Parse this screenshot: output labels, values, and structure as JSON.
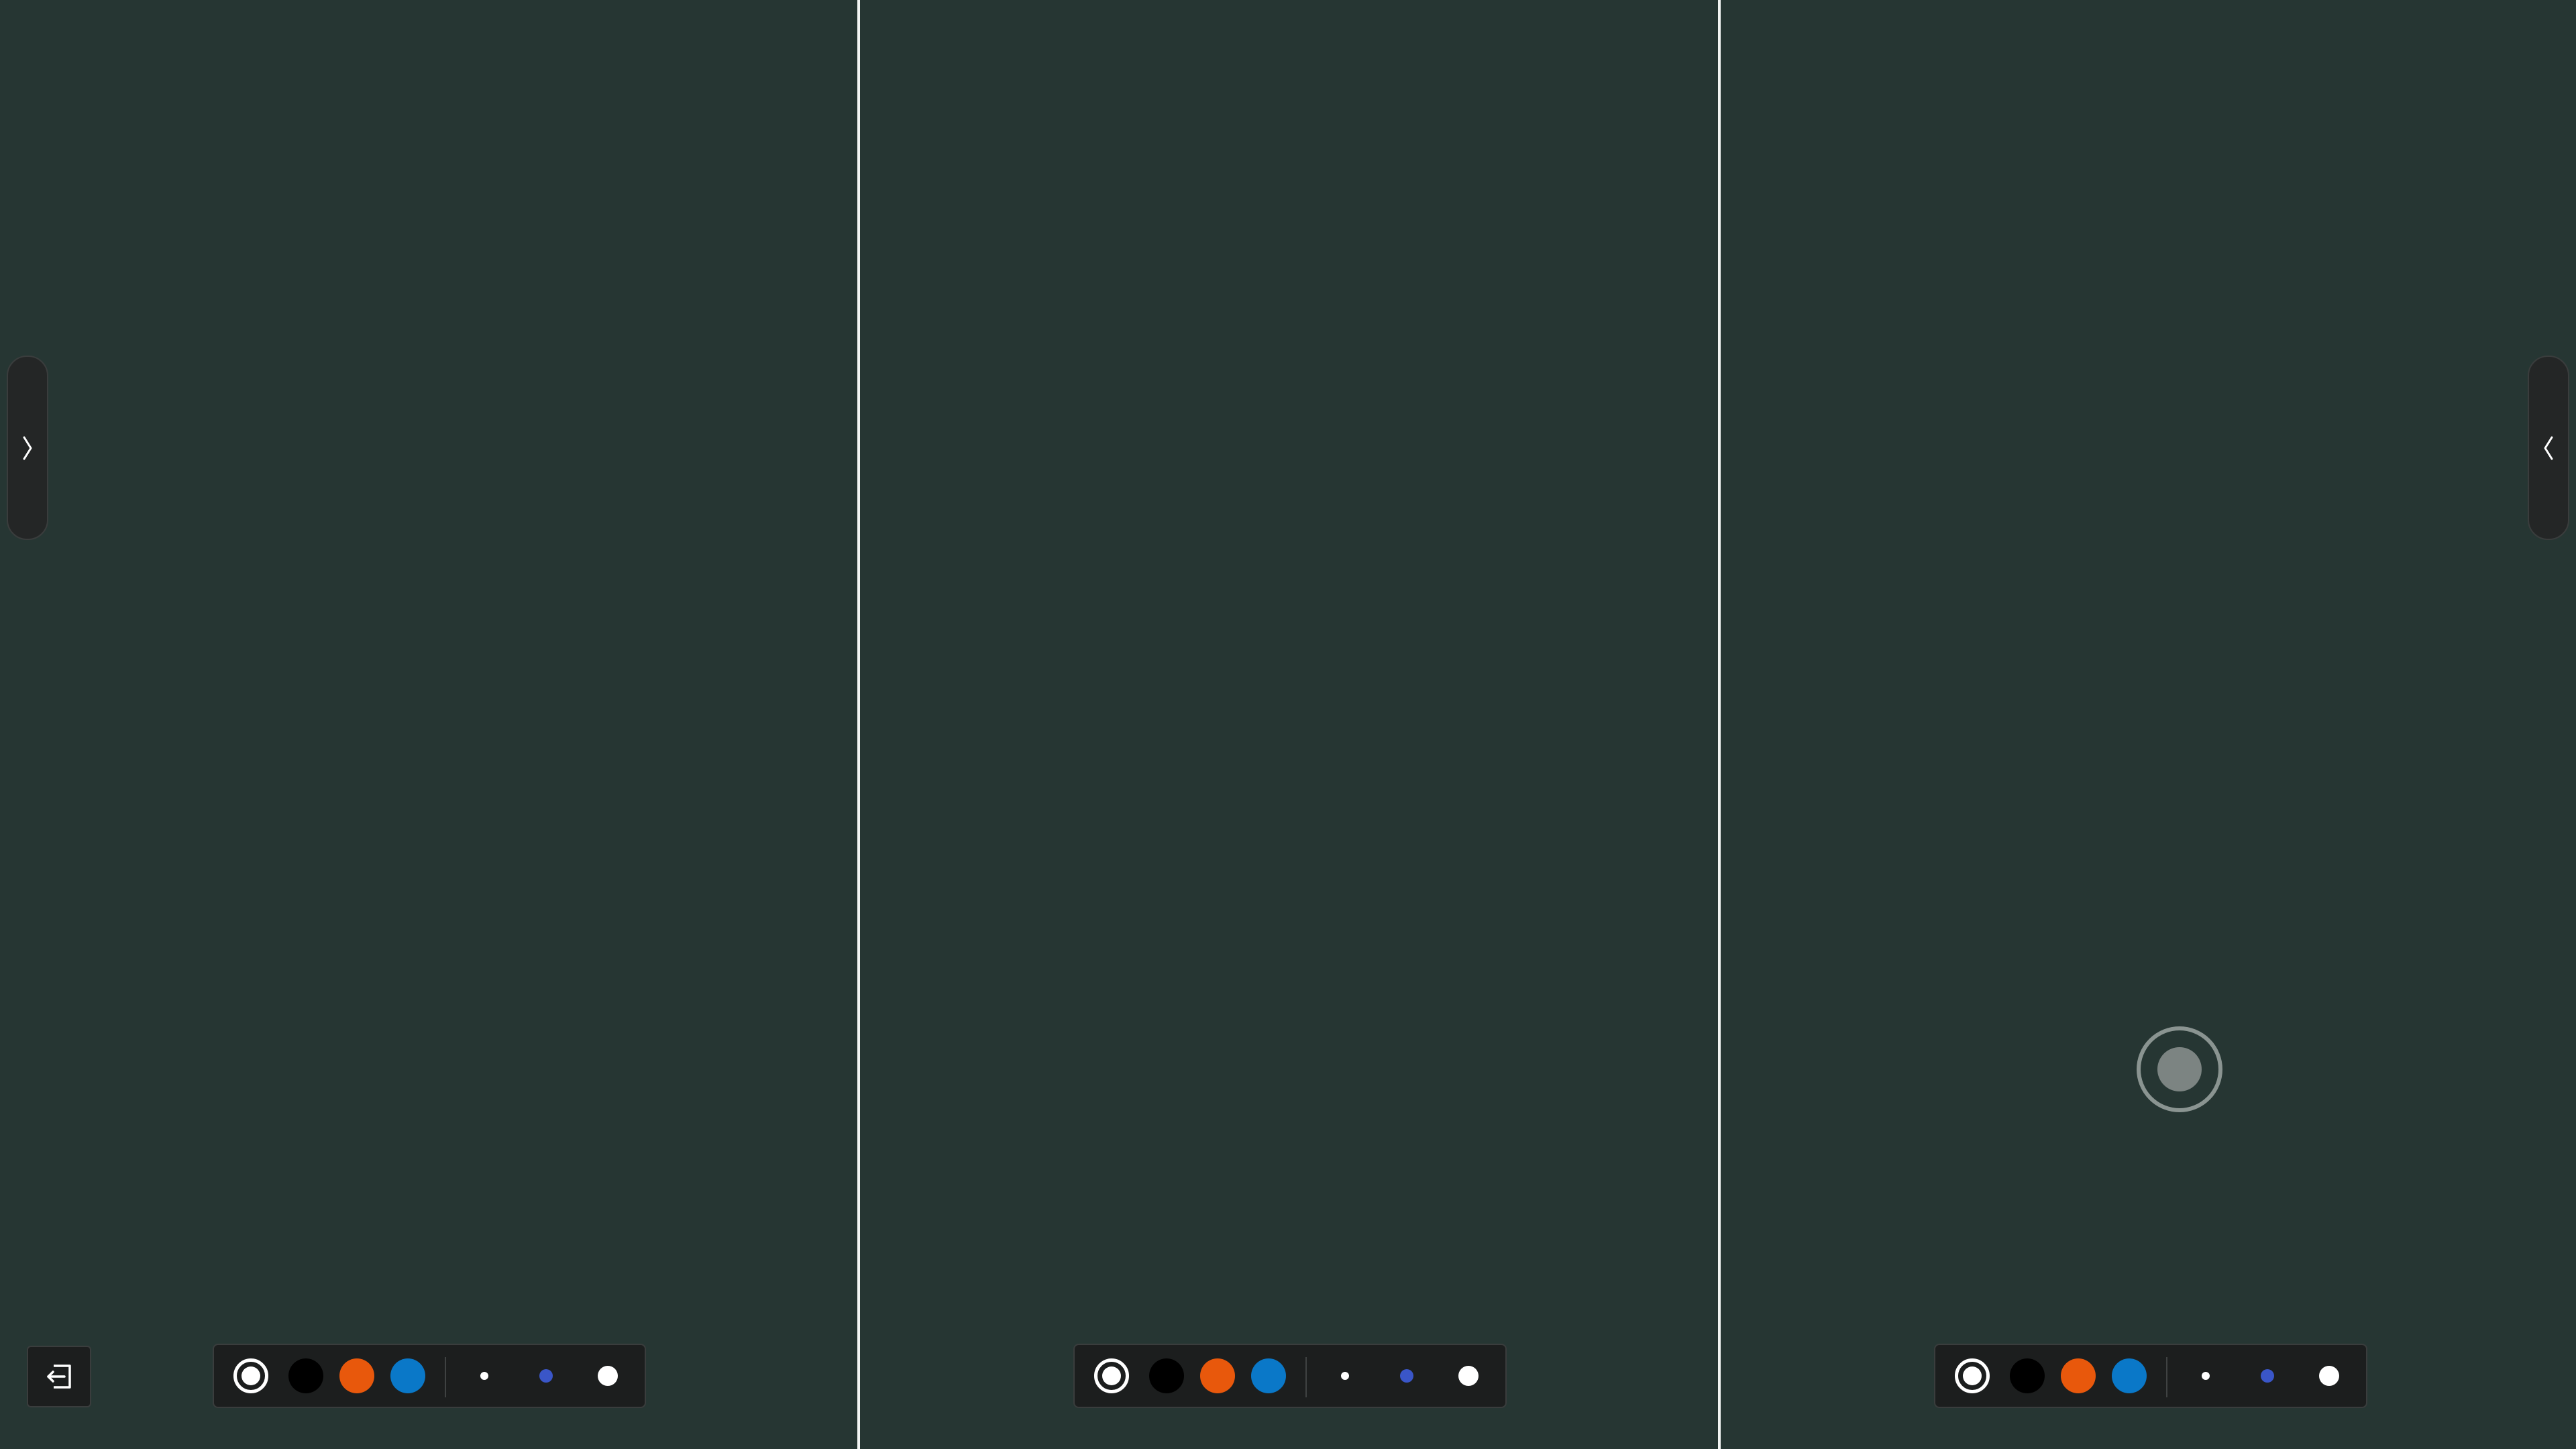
{
  "board": {
    "background": "#263633",
    "divider_color": "#f2f4f3"
  },
  "side_handles": {
    "left": {
      "icon": "chevron-right-icon"
    },
    "right": {
      "icon": "chevron-left-icon"
    }
  },
  "exit_button": {
    "icon": "exit-icon"
  },
  "toolbar": {
    "pen_tool": {
      "icon": "pen-ring-icon",
      "selected": true
    },
    "colors": [
      {
        "name": "black",
        "hex": "#000000"
      },
      {
        "name": "orange",
        "hex": "#e8580c"
      },
      {
        "name": "blue",
        "hex": "#0a78c8"
      }
    ],
    "sizes": [
      {
        "name": "small",
        "hex": "#ffffff"
      },
      {
        "name": "medium",
        "hex": "#3a56c8"
      },
      {
        "name": "large",
        "hex": "#ffffff"
      }
    ]
  },
  "panels": [
    {
      "name": "panel-1",
      "has_toolbar": true
    },
    {
      "name": "panel-2",
      "has_toolbar": true
    },
    {
      "name": "panel-3",
      "has_toolbar": true,
      "cursor_marker": true
    }
  ]
}
